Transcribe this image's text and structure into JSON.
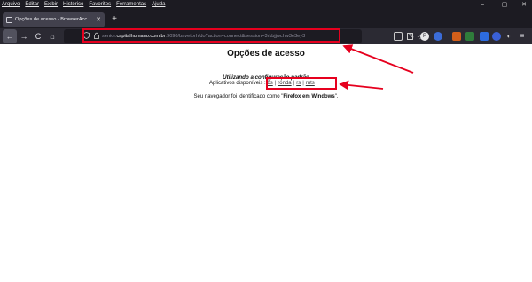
{
  "menubar": {
    "items": [
      "Arquivo",
      "Editar",
      "Exibir",
      "Histórico",
      "Favoritos",
      "Ferramentas",
      "Ajuda"
    ]
  },
  "window_controls": {
    "minimize": "–",
    "maximize": "▢",
    "close": "✕"
  },
  "tab": {
    "title": "Opções de acesso - BrowserAcc",
    "close": "✕"
  },
  "new_tab": "+",
  "nav": {
    "back": "←",
    "forward": "→",
    "reload": "C",
    "home": "⌂"
  },
  "url": {
    "prefix": "senior.",
    "host": "capitalhumano.com.br",
    "path": ":9090/bavetorh/do?action=connect&session=3rkbjjwchw3e3ey3"
  },
  "page": {
    "heading": "Opções de acesso",
    "config_label": "Utilizando a configuração padrão",
    "apps_label": "Aplicativos disponíveis",
    "apps": [
      "bs",
      "ronda",
      "rs",
      "ruts"
    ],
    "browser_prefix": "Seu navegador foi identificado como \"",
    "browser_name": "Firefox em Windows",
    "browser_suffix": "\"."
  },
  "colors": {
    "highlight": "#e6001e",
    "chrome_dark": "#1c1b22",
    "toolbar": "#2b2a33"
  }
}
